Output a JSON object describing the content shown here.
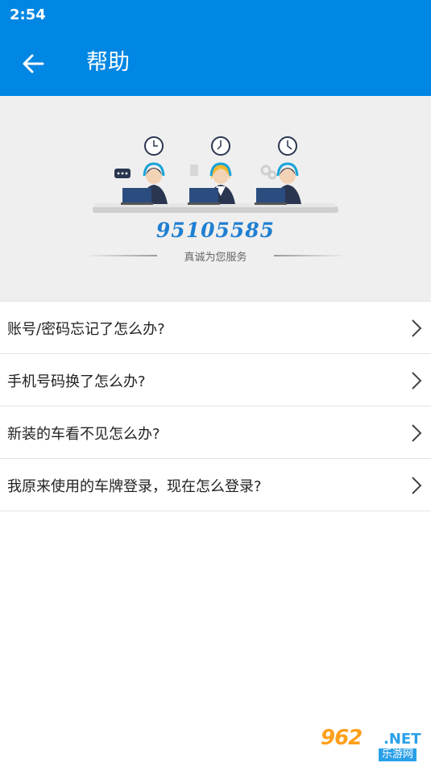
{
  "status_bar": {
    "time": "2:54"
  },
  "app_bar": {
    "title": "帮助",
    "back_icon": "arrow-left-icon"
  },
  "banner": {
    "phone": "95105585",
    "slogan": "真诚为您服务"
  },
  "faq": [
    {
      "label": "账号/密码忘记了怎么办?"
    },
    {
      "label": "手机号码换了怎么办?"
    },
    {
      "label": "新装的车看不见怎么办?"
    },
    {
      "label": "我原来使用的车牌登录，现在怎么登录?"
    }
  ],
  "watermark": {
    "number": "962",
    "net": ".NET",
    "sub": "乐游网"
  },
  "colors": {
    "primary": "#0086e3",
    "accent": "#1f7fd1"
  }
}
